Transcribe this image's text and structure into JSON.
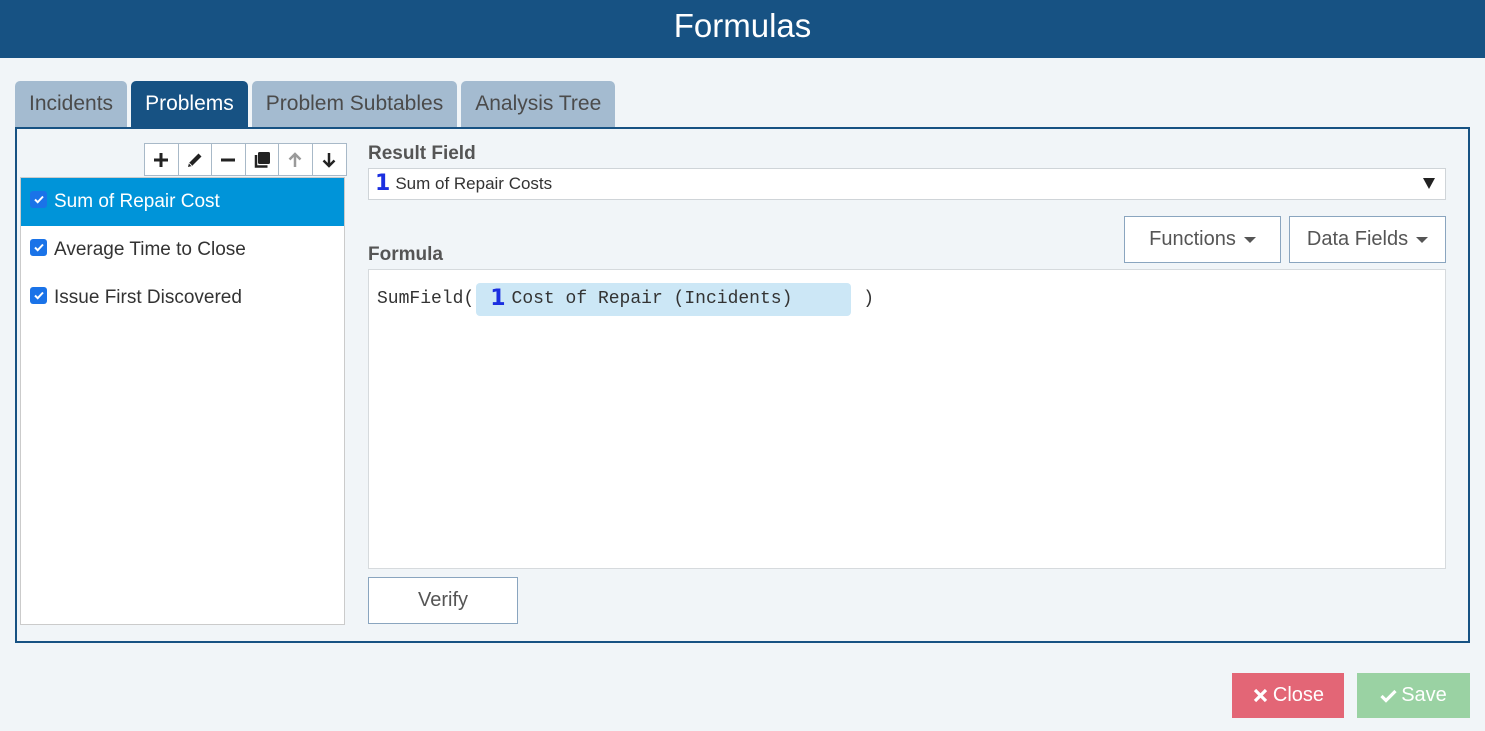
{
  "header": {
    "title": "Formulas"
  },
  "tabs": [
    {
      "label": "Incidents",
      "active": false
    },
    {
      "label": "Problems",
      "active": true
    },
    {
      "label": "Problem Subtables",
      "active": false
    },
    {
      "label": "Analysis Tree",
      "active": false
    }
  ],
  "toolbar": {
    "buttons": [
      {
        "icon": "plus-icon",
        "label": "Add",
        "enabled": true
      },
      {
        "icon": "pencil-icon",
        "label": "Edit",
        "enabled": true
      },
      {
        "icon": "minus-icon",
        "label": "Remove",
        "enabled": true
      },
      {
        "icon": "copy-icon",
        "label": "Duplicate",
        "enabled": true
      },
      {
        "icon": "arrow-up-icon",
        "label": "Move Up",
        "enabled": false
      },
      {
        "icon": "arrow-down-icon",
        "label": "Move Down",
        "enabled": true
      }
    ]
  },
  "formula_list": {
    "items": [
      {
        "label": "Sum of Repair Cost",
        "checked": true,
        "selected": true
      },
      {
        "label": "Average Time to Close",
        "checked": true,
        "selected": false
      },
      {
        "label": "Issue First Discovered",
        "checked": true,
        "selected": false
      }
    ]
  },
  "result_field": {
    "label": "Result Field",
    "type_icon": "1",
    "value": "Sum of Repair Costs"
  },
  "formula": {
    "label": "Formula",
    "functions_label": "Functions",
    "data_fields_label": "Data Fields",
    "prefix": "SumField(",
    "token_icon": "1",
    "token_text": "Cost of Repair (Incidents)",
    "suffix": ")"
  },
  "actions": {
    "verify_label": "Verify",
    "close_label": "Close",
    "save_label": "Save"
  },
  "colors": {
    "header_bg": "#175283",
    "tab_active": "#175283",
    "tab_inactive": "#a4bbd0",
    "selected_item": "#0094d9",
    "close": "#e36676",
    "save": "#9ad2a3",
    "token_bg": "#cce7f6"
  }
}
